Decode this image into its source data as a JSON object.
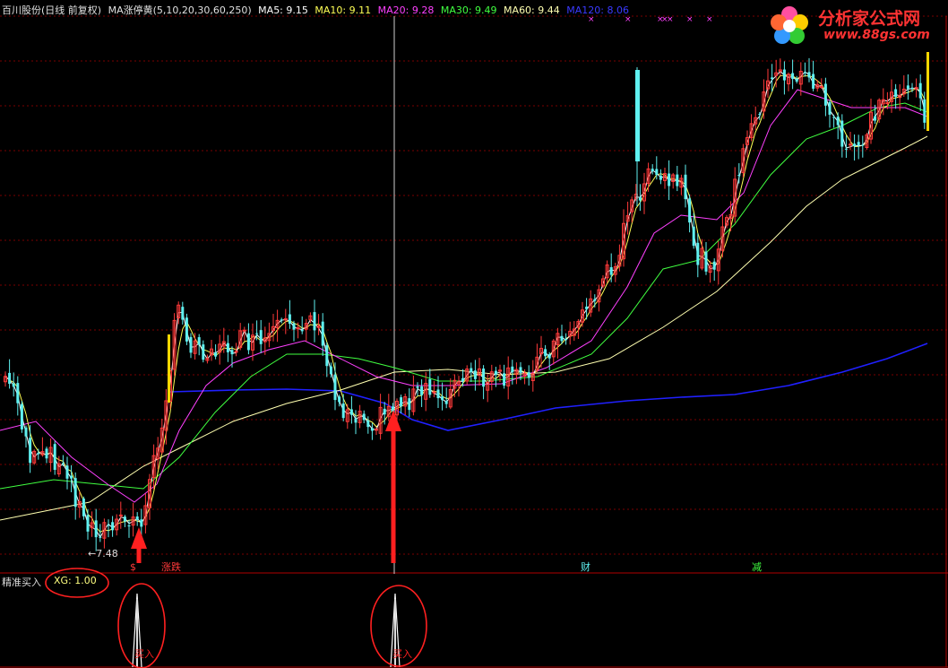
{
  "header": {
    "title": "百川股份(日线 前复权)",
    "indicator": "MA涨停黄(5,10,20,30,60,250)",
    "ma5": "MA5: 9.15",
    "ma10": "MA10: 9.11",
    "ma20": "MA20: 9.28",
    "ma30": "MA30: 9.49",
    "ma60": "MA60: 9.44",
    "ma120": "MA120: 8.06"
  },
  "colors": {
    "background": "#000000",
    "up": "#ff3a3a",
    "down": "#5ff0f0",
    "ma5": "#ffffff",
    "ma10": "#ffff55",
    "ma20": "#ff40ff",
    "ma30": "#40ff40",
    "ma60": "#ffffb0",
    "ma120": "#2020ff",
    "limit_up": "#ffd700",
    "annotation": "#ff2020"
  },
  "low_marker": "←7.48",
  "event_markers": [
    "$",
    "涨跌",
    "财",
    "减"
  ],
  "subpanel": {
    "label": "精准买入",
    "xg": "XG: 1.00",
    "signal_text": "买入"
  },
  "logo": {
    "text": "分析家公式网",
    "url": "www.88gs.com",
    "icon": "flower-icon"
  },
  "chart_data": {
    "type": "candlestick",
    "title": "百川股份(日线 前复权)",
    "y_reference_low": 7.48,
    "ma_legend": [
      {
        "name": "MA5",
        "value": 9.15
      },
      {
        "name": "MA10",
        "value": 9.11
      },
      {
        "name": "MA20",
        "value": 9.28
      },
      {
        "name": "MA30",
        "value": 9.49
      },
      {
        "name": "MA60",
        "value": 9.44
      },
      {
        "name": "MA120",
        "value": 8.06
      }
    ],
    "indicator": {
      "name": "精准买入",
      "xg": 1.0,
      "signals": 2
    }
  }
}
